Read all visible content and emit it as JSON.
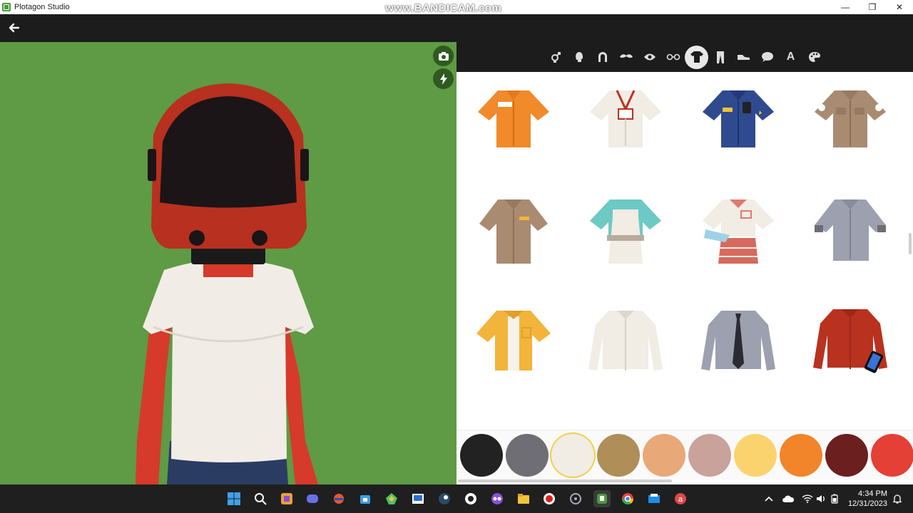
{
  "window": {
    "title": "Plotagon Studio",
    "watermark": "www.BANDICAM.com",
    "controls": {
      "minimize": "—",
      "maximize": "❐",
      "close": "✕"
    }
  },
  "appbar": {
    "back_icon": "arrow-left-icon"
  },
  "viewport": {
    "background": "#5f9a45",
    "buttons": [
      {
        "name": "camera-icon"
      },
      {
        "name": "lightning-icon"
      }
    ]
  },
  "categories": [
    {
      "name": "gender-icon",
      "active": false
    },
    {
      "name": "head-icon",
      "active": false
    },
    {
      "name": "hair-icon",
      "active": false
    },
    {
      "name": "mustache-icon",
      "active": false
    },
    {
      "name": "eye-icon",
      "active": false
    },
    {
      "name": "glasses-icon",
      "active": false
    },
    {
      "name": "shirt-icon",
      "active": true
    },
    {
      "name": "pants-icon",
      "active": false
    },
    {
      "name": "shoe-icon",
      "active": false
    },
    {
      "name": "speech-bubble-icon",
      "active": false
    },
    {
      "name": "text-icon",
      "active": false,
      "label": "A"
    },
    {
      "name": "palette-icon",
      "active": false
    }
  ],
  "clothing_items": [
    {
      "name": "orange-short-sleeve-shirt",
      "color": "#f08a2a"
    },
    {
      "name": "white-shirt-with-lanyard",
      "color": "#f1ece4"
    },
    {
      "name": "blue-police-shirt",
      "color": "#2f4a8f"
    },
    {
      "name": "brown-uniform-shirt",
      "color": "#a98b72"
    },
    {
      "name": "brown-short-sleeve-shirt",
      "color": "#a98b72"
    },
    {
      "name": "teal-shirt-with-apron",
      "color": "#6cc9c4"
    },
    {
      "name": "waitress-uniform",
      "color": "#f1ece4"
    },
    {
      "name": "grey-shirt",
      "color": "#9da0ae"
    },
    {
      "name": "yellow-open-shirt",
      "color": "#f2b43a"
    },
    {
      "name": "white-long-sleeve-shirt",
      "color": "#f1ece4"
    },
    {
      "name": "grey-shirt-with-tie",
      "color": "#9da0ae"
    },
    {
      "name": "red-long-sleeve-shirt",
      "color": "#b8321f"
    }
  ],
  "swatches": [
    {
      "color": "#222222",
      "selected": false
    },
    {
      "color": "#6e6e74",
      "selected": false
    },
    {
      "color": "#f1ece4",
      "selected": true
    },
    {
      "color": "#b08e58",
      "selected": false
    },
    {
      "color": "#e9a877",
      "selected": false
    },
    {
      "color": "#c9a29c",
      "selected": false
    },
    {
      "color": "#fbd36e",
      "selected": false
    },
    {
      "color": "#f28429",
      "selected": false
    },
    {
      "color": "#6b1f1f",
      "selected": false
    },
    {
      "color": "#e44035",
      "selected": false
    }
  ],
  "taskbar": {
    "icons": [
      "windows-start-icon",
      "search-icon",
      "notes-icon",
      "discord-icon",
      "app-icon",
      "store-icon",
      "app-icon",
      "whiteboard-icon",
      "steam-icon",
      "github-icon",
      "app-icon",
      "file-explorer-icon",
      "record-icon",
      "app-icon",
      "plotagon-icon",
      "chrome-icon",
      "app-icon",
      "app-icon"
    ],
    "time": "4:34 PM",
    "date": "12/31/2023"
  }
}
